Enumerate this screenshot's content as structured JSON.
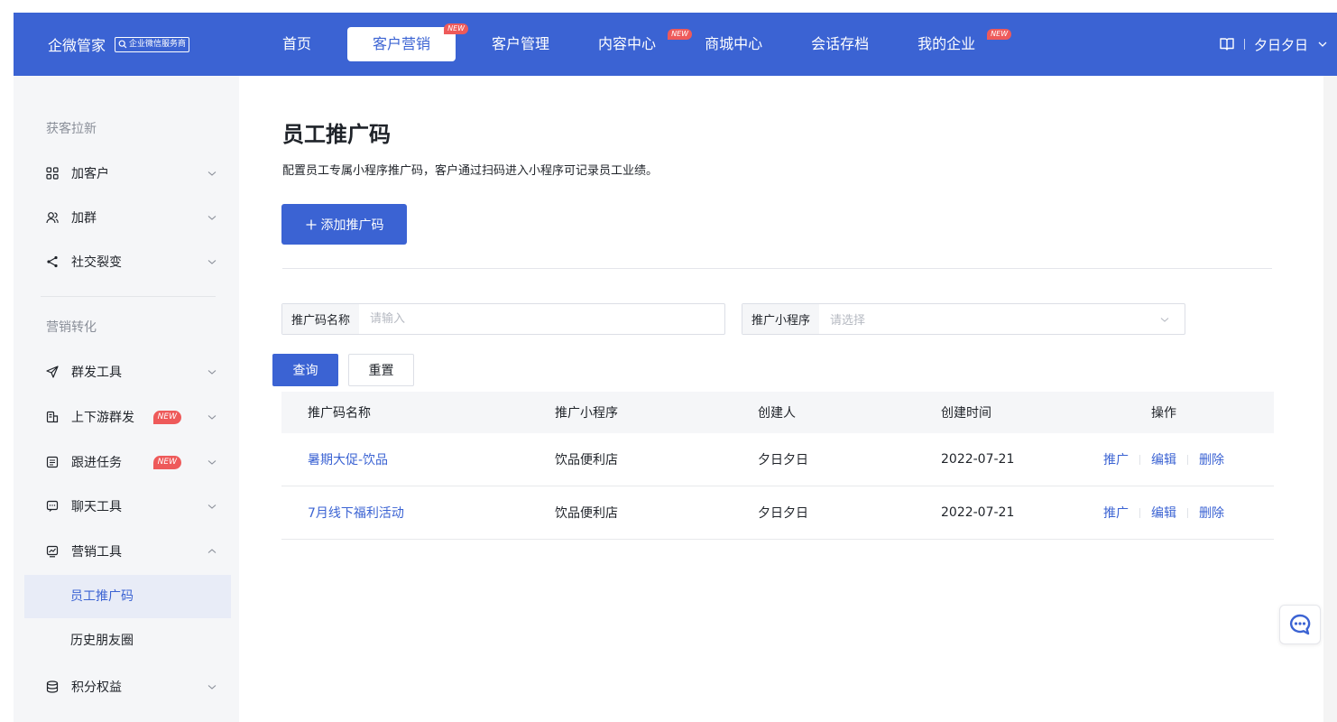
{
  "brand": {
    "name": "企微管家",
    "tag": "企业微信服务商"
  },
  "nav": {
    "items": [
      {
        "label": "首页",
        "badge": ""
      },
      {
        "label": "客户营销",
        "badge": "NEW"
      },
      {
        "label": "客户管理",
        "badge": ""
      },
      {
        "label": "内容中心",
        "badge": "NEW"
      },
      {
        "label": "商城中心",
        "badge": ""
      },
      {
        "label": "会话存档",
        "badge": ""
      },
      {
        "label": "我的企业",
        "badge": "NEW"
      }
    ],
    "active_index": 1
  },
  "user": {
    "name": "夕日夕日"
  },
  "sidebar": {
    "group1_title": "获客拉新",
    "group1_items": [
      {
        "label": "加客户"
      },
      {
        "label": "加群"
      },
      {
        "label": "社交裂变"
      }
    ],
    "group2_title": "营销转化",
    "group2_items": [
      {
        "label": "群发工具",
        "badge": ""
      },
      {
        "label": "上下游群发",
        "badge": "NEW"
      },
      {
        "label": "跟进任务",
        "badge": "NEW"
      },
      {
        "label": "聊天工具",
        "badge": ""
      },
      {
        "label": "营销工具",
        "badge": ""
      }
    ],
    "sub_items": [
      {
        "label": "员工推广码"
      },
      {
        "label": "历史朋友圈"
      }
    ],
    "last_item": {
      "label": "积分权益"
    }
  },
  "page": {
    "title": "员工推广码",
    "description": "配置员工专属小程序推广码，客户通过扫码进入小程序可记录员工业绩。",
    "add_button": "添加推广码"
  },
  "filters": {
    "name_label": "推广码名称",
    "name_value": "",
    "name_placeholder": "请输入",
    "app_label": "推广小程序",
    "app_placeholder": "请选择",
    "query_button": "查询",
    "reset_button": "重置"
  },
  "table": {
    "headers": [
      "推广码名称",
      "推广小程序",
      "创建人",
      "创建时间",
      "操作"
    ],
    "rows": [
      {
        "name": "暑期大促-饮品",
        "app": "饮品便利店",
        "creator": "夕日夕日",
        "created": "2022-07-21"
      },
      {
        "name": "7月线下福利活动",
        "app": "饮品便利店",
        "creator": "夕日夕日",
        "created": "2022-07-21"
      }
    ],
    "actions": {
      "promote": "推广",
      "edit": "编辑",
      "delete": "删除"
    }
  },
  "colors": {
    "primary": "#3b63d3",
    "badge": "#ee5a5a",
    "sidebar_bg": "#f5f6f8"
  }
}
